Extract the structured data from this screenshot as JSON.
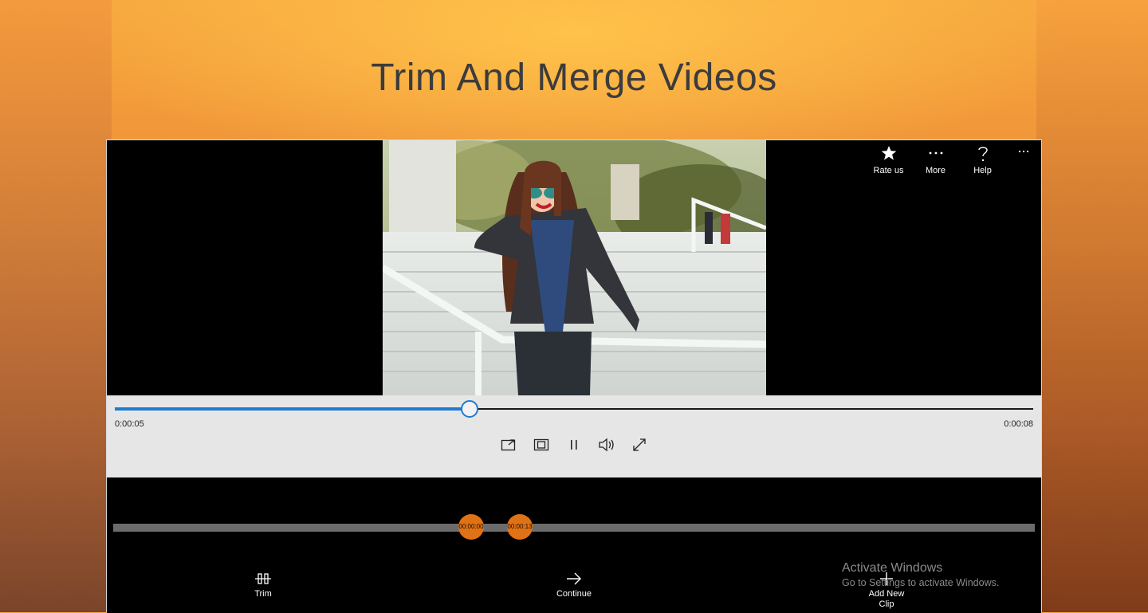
{
  "headline": "Trim And Merge Videos",
  "topbar": {
    "rate": {
      "label": "Rate us",
      "icon": "star-icon"
    },
    "more": {
      "label": "More",
      "icon": "more-icon"
    },
    "help": {
      "label": "Help",
      "icon": "help-icon"
    },
    "overflow_icon": "ellipsis-icon"
  },
  "player": {
    "current_time": "0:00:05",
    "total_time": "0:00:08",
    "progress": 0.385,
    "controls": [
      "cast-icon",
      "aspect-ratio-icon",
      "pause-icon",
      "volume-icon",
      "fullscreen-icon"
    ]
  },
  "timeline": {
    "start_marker": "00:00:00",
    "end_marker": "00:00:13"
  },
  "actions": {
    "trim": "Trim",
    "continue": "Continue",
    "add_clip": "Add New Clip"
  },
  "watermark": {
    "title": "Activate Windows",
    "subtitle": "Go to Settings to activate Windows."
  },
  "colors": {
    "accent": "#1e7bd3",
    "marker": "#e07216",
    "background_top": "#f7a93e"
  }
}
